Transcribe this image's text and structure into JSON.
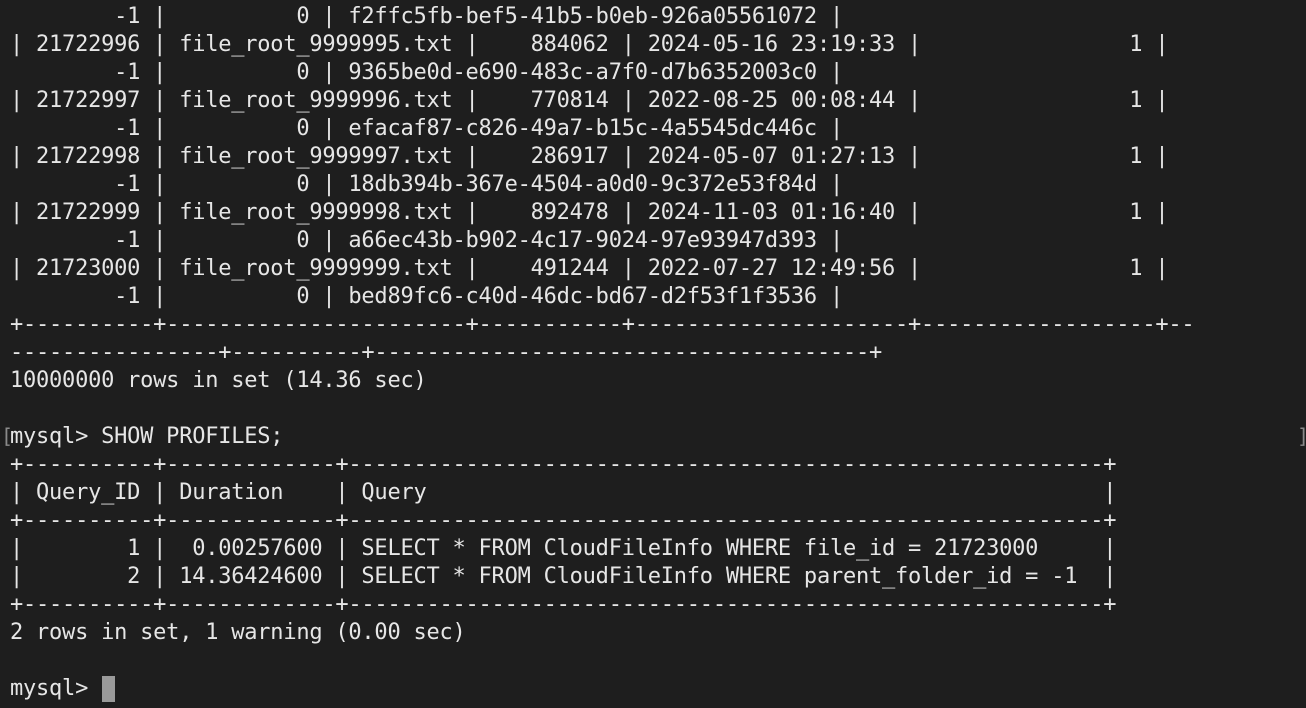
{
  "terminal": {
    "previous_output": [
      "        -1 |          0 | f2ffc5fb-bef5-41b5-b0eb-926a05561072 |",
      "| 21722996 | file_root_9999995.txt |    884062 | 2024-05-16 23:19:33 |                1 |",
      "        -1 |          0 | 9365be0d-e690-483c-a7f0-d7b6352003c0 |",
      "| 21722997 | file_root_9999996.txt |    770814 | 2022-08-25 00:08:44 |                1 |",
      "        -1 |          0 | efacaf87-c826-49a7-b15c-4a5545dc446c |",
      "| 21722998 | file_root_9999997.txt |    286917 | 2024-05-07 01:27:13 |                1 |",
      "        -1 |          0 | 18db394b-367e-4504-a0d0-9c372e53f84d |",
      "| 21722999 | file_root_9999998.txt |    892478 | 2024-11-03 01:16:40 |                1 |",
      "        -1 |          0 | a66ec43b-b902-4c17-9024-97e93947d393 |",
      "| 21723000 | file_root_9999999.txt |    491244 | 2022-07-27 12:49:56 |                1 |",
      "        -1 |          0 | bed89fc6-c40d-46dc-bd67-d2f53f1f3536 |",
      "+----------+-----------------------+-----------+---------------------+------------------+--",
      "----------------+----------+--------------------------------------+",
      "10000000 rows in set (14.36 sec)",
      ""
    ],
    "command": {
      "prompt": "mysql> ",
      "text": "SHOW PROFILES;"
    },
    "profiles_table": {
      "border": "+----------+-------------+----------------------------------------------------------+",
      "header": "| Query_ID | Duration    | Query                                                    |",
      "rows": [
        "|        1 |  0.00257600 | SELECT * FROM CloudFileInfo WHERE file_id = 21723000     |",
        "|        2 | 14.36424600 | SELECT * FROM CloudFileInfo WHERE parent_folder_id = -1  |"
      ],
      "columns": [
        "Query_ID",
        "Duration",
        "Query"
      ],
      "data": [
        {
          "query_id": "1",
          "duration": "0.00257600",
          "query": "SELECT * FROM CloudFileInfo WHERE file_id = 21723000"
        },
        {
          "query_id": "2",
          "duration": "14.36424600",
          "query": "SELECT * FROM CloudFileInfo WHERE parent_folder_id = -1"
        }
      ]
    },
    "result_summary": "2 rows in set, 1 warning (0.00 sec)",
    "blank": "",
    "current_prompt": "mysql> ",
    "scroll_mark_left": "[",
    "scroll_mark_right": "]",
    "colors": {
      "background": "#1e1e1e",
      "text": "#e6e6e6",
      "cursor": "#9a9a9a"
    }
  }
}
